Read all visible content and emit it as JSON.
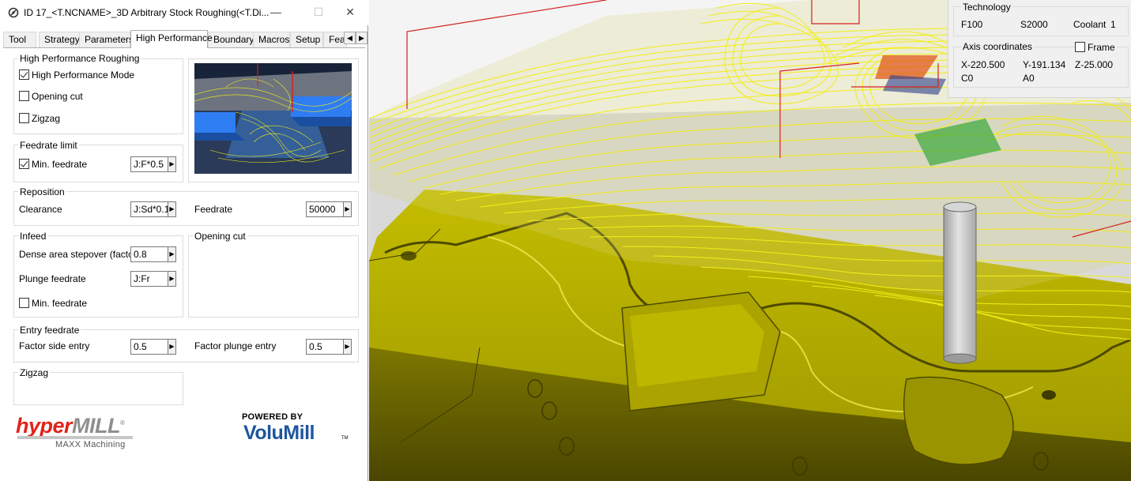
{
  "window": {
    "title": "ID 17_<T.NCNAME>_3D Arbitrary Stock Roughing(<T.Di...",
    "minimize_glyph": "—",
    "maximize_glyph": "☐",
    "close_glyph": "✕"
  },
  "tabs": [
    {
      "label": "Tool"
    },
    {
      "label": "Strategy"
    },
    {
      "label": "Parameters"
    },
    {
      "label": "High Performance",
      "active": true
    },
    {
      "label": "Boundary"
    },
    {
      "label": "Macros"
    },
    {
      "label": "Setup"
    },
    {
      "label": "Fea"
    }
  ],
  "tab_scroll": {
    "left": "◀",
    "right": "▶"
  },
  "hp_roughing": {
    "title": "High Performance Roughing",
    "hp_mode": {
      "label": "High Performance Mode",
      "checked": true
    },
    "opening_cut": {
      "label": "Opening cut",
      "checked": false
    },
    "zigzag": {
      "label": "Zigzag",
      "checked": false
    }
  },
  "feedrate_limit": {
    "title": "Feedrate limit",
    "min_feedrate": {
      "label": "Min. feedrate",
      "checked": true,
      "value": "J:F*0.5"
    }
  },
  "reposition": {
    "title": "Reposition",
    "clearance_label": "Clearance",
    "clearance_value": "J:Sd*0.1",
    "feedrate_label": "Feedrate",
    "feedrate_value": "50000"
  },
  "infeed": {
    "title": "Infeed",
    "dense_label": "Dense area stepover (factor)",
    "dense_value": "0.8",
    "plunge_label": "Plunge feedrate",
    "plunge_value": "J:Fr",
    "min_feedrate": {
      "label": "Min. feedrate",
      "checked": false
    }
  },
  "opening_cut_group": {
    "title": "Opening cut"
  },
  "entry_feedrate": {
    "title": "Entry feedrate",
    "side_label": "Factor side entry",
    "side_value": "0.5",
    "plunge_label": "Factor plunge entry",
    "plunge_value": "0.5"
  },
  "zigzag_group": {
    "title": "Zigzag"
  },
  "logos": {
    "hypermill_a": "hyper",
    "hypermill_b": "MILL",
    "hypermill_reg": "®",
    "hypermill_sub": "MAXX Machining",
    "volumill_top": "POWERED BY",
    "volumill": "VoluMill",
    "volumill_tm": "TM"
  },
  "arrow_glyph": "▶",
  "technology": {
    "title": "Technology",
    "feed": "F100",
    "speed": "S2000",
    "coolant_label": "Coolant",
    "coolant_value": "1"
  },
  "axis": {
    "title": "Axis coordinates",
    "frame": {
      "label": "Frame",
      "checked": false
    },
    "x": "X-220.500",
    "y": "Y-191.134",
    "z": "Z-25.000",
    "c": "C0",
    "a": "A0"
  },
  "colors": {
    "part": "#b2ab00",
    "part_dark": "#5c5800",
    "toolpath": "#f2ee16",
    "tool": "#c8c8c8",
    "frame_red": "#d62020",
    "accent_blue": "#1e56a0",
    "hyper_red": "#e2231a"
  }
}
